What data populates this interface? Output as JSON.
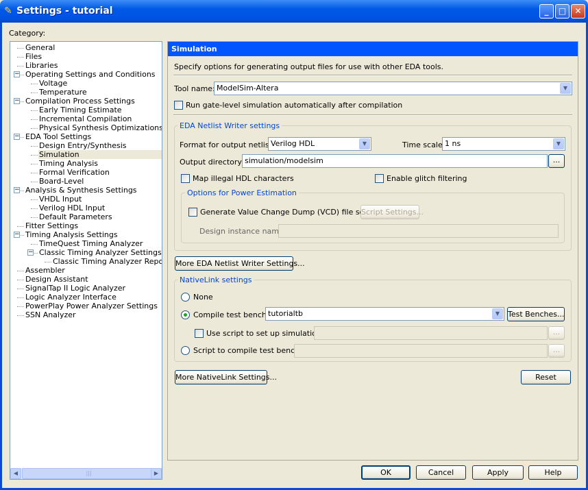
{
  "window": {
    "title": "Settings - tutorial",
    "minimize": "_",
    "maximize": "□",
    "close": "✕"
  },
  "category_label": "Category:",
  "tree": [
    {
      "label": "General",
      "level": 0
    },
    {
      "label": "Files",
      "level": 0
    },
    {
      "label": "Libraries",
      "level": 0
    },
    {
      "label": "Operating Settings and Conditions",
      "level": 0,
      "expander": "−"
    },
    {
      "label": "Voltage",
      "level": 1
    },
    {
      "label": "Temperature",
      "level": 1
    },
    {
      "label": "Compilation Process Settings",
      "level": 0,
      "expander": "−"
    },
    {
      "label": "Early Timing Estimate",
      "level": 1
    },
    {
      "label": "Incremental Compilation",
      "level": 1
    },
    {
      "label": "Physical Synthesis Optimizations",
      "level": 1
    },
    {
      "label": "EDA Tool Settings",
      "level": 0,
      "expander": "−"
    },
    {
      "label": "Design Entry/Synthesis",
      "level": 1
    },
    {
      "label": "Simulation",
      "level": 1,
      "selected": true
    },
    {
      "label": "Timing Analysis",
      "level": 1
    },
    {
      "label": "Formal Verification",
      "level": 1
    },
    {
      "label": "Board-Level",
      "level": 1
    },
    {
      "label": "Analysis & Synthesis Settings",
      "level": 0,
      "expander": "−"
    },
    {
      "label": "VHDL Input",
      "level": 1
    },
    {
      "label": "Verilog HDL Input",
      "level": 1
    },
    {
      "label": "Default Parameters",
      "level": 1
    },
    {
      "label": "Fitter Settings",
      "level": 0
    },
    {
      "label": "Timing Analysis Settings",
      "level": 0,
      "expander": "−"
    },
    {
      "label": "TimeQuest Timing Analyzer",
      "level": 1
    },
    {
      "label": "Classic Timing Analyzer Settings",
      "level": 1,
      "expander": "−"
    },
    {
      "label": "Classic Timing Analyzer Reporting",
      "level": 2
    },
    {
      "label": "Assembler",
      "level": 0
    },
    {
      "label": "Design Assistant",
      "level": 0
    },
    {
      "label": "SignalTap II Logic Analyzer",
      "level": 0
    },
    {
      "label": "Logic Analyzer Interface",
      "level": 0
    },
    {
      "label": "PowerPlay Power Analyzer Settings",
      "level": 0
    },
    {
      "label": "SSN Analyzer",
      "level": 0
    }
  ],
  "panel": {
    "title": "Simulation",
    "description": "Specify options for generating output files for use with other EDA tools.",
    "tool_name_label": "Tool name:",
    "tool_name_value": "ModelSim-Altera",
    "run_gate_level": {
      "label": "Run gate-level simulation automatically after compilation",
      "checked": false
    },
    "netlist_group": {
      "title": "EDA Netlist Writer settings",
      "format_label": "Format for output netlist:",
      "format_value": "Verilog HDL",
      "timescale_label": "Time scale:",
      "timescale_value": "1 ns",
      "outdir_label": "Output directory:",
      "outdir_value": "simulation/modelsim",
      "browse": "...",
      "map_illegal": {
        "label": "Map illegal HDL characters",
        "checked": false
      },
      "glitch": {
        "label": "Enable glitch filtering",
        "checked": false
      },
      "power_group": {
        "title": "Options for Power Estimation",
        "vcd": {
          "label": "Generate Value Change Dump (VCD) file script",
          "checked": false
        },
        "script_settings": "Script Settings...",
        "instance_label": "Design instance name:",
        "instance_value": ""
      }
    },
    "more_netlist": "More EDA Netlist Writer Settings...",
    "nativelink": {
      "title": "NativeLink settings",
      "none": "None",
      "compile_tb": "Compile test bench:",
      "compile_tb_value": "tutorialtb",
      "test_benches": "Test Benches...",
      "use_script": "Use script to set up simulation:",
      "use_script_value": "",
      "browse": "...",
      "script_compile": "Script to compile test bench:",
      "script_compile_value": "",
      "selected": "compile_tb"
    },
    "more_nativelink": "More NativeLink Settings...",
    "reset": "Reset"
  },
  "buttons": {
    "ok": "OK",
    "cancel": "Cancel",
    "apply": "Apply",
    "help": "Help"
  }
}
